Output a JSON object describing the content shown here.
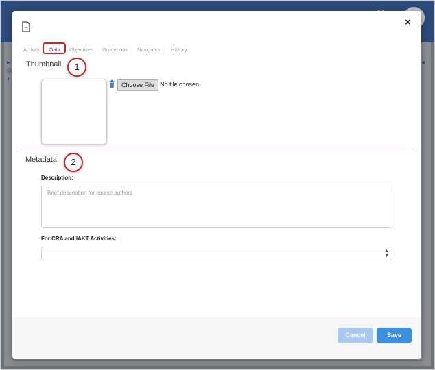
{
  "background": {
    "user_label": "Ms",
    "left_icons": [
      "▸",
      "◎",
      "◐"
    ],
    "right_arrow": "◂"
  },
  "modal": {
    "icon": "document-icon",
    "close_label": "×",
    "tabs": [
      {
        "label": "Activity"
      },
      {
        "label": "Data"
      },
      {
        "label": "Objectives"
      },
      {
        "label": "Gradebook"
      },
      {
        "label": "Navigation"
      },
      {
        "label": "History"
      }
    ],
    "active_tab": "Data",
    "callouts": [
      "1",
      "2"
    ],
    "thumbnail": {
      "title": "Thumbnail",
      "choose_file_label": "Choose File",
      "file_status": "No file chosen"
    },
    "metadata": {
      "title": "Metadata",
      "description_label": "Description:",
      "description_placeholder": "Brief description for course authors",
      "description_value": "",
      "cra_label": "For CRA and IAKT Activities:",
      "cra_selected": ""
    },
    "footer": {
      "cancel_label": "Cancel",
      "save_label": "Save"
    }
  },
  "colors": {
    "accent": "#3d8fe0",
    "active_tab": "#7a3fa8",
    "callout_border": "#c62828",
    "divider": "#c79ad8"
  }
}
